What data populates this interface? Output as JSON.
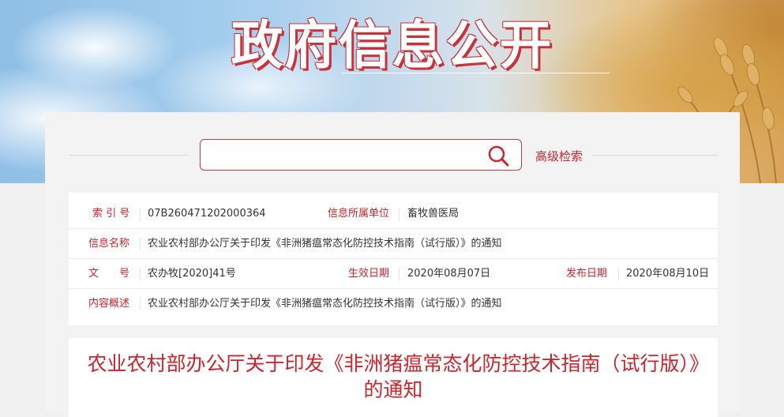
{
  "banner": {
    "title": "政府信息公开"
  },
  "search": {
    "placeholder": "",
    "value": "",
    "advanced_label": "高级检索"
  },
  "meta": {
    "index_label": "索 引 号",
    "index_value": "07B260471202000364",
    "unit_label": "信息所属单位",
    "unit_value": "畜牧兽医局",
    "name_label": "信息名称",
    "name_value": "农业农村部办公厅关于印发《非洲猪瘟常态化防控技术指南（试行版）》的通知",
    "doc_label": "文　　号",
    "doc_value": "农办牧[2020]41号",
    "effective_label": "生效日期",
    "effective_value": "2020年08月07日",
    "publish_label": "发布日期",
    "publish_value": "2020年08月10日",
    "summary_label": "内容概述",
    "summary_value": "农业农村部办公厅关于印发《非洲猪瘟常态化防控技术指南（试行版）》的通知"
  },
  "article": {
    "title": "农业农村部办公厅关于印发《非洲猪瘟常态化防控技术指南（试行版）》的通知"
  },
  "colors": {
    "accent": "#c9252d",
    "banner_sky": "#a9d0ee",
    "banner_wheat": "#d9a45a"
  }
}
